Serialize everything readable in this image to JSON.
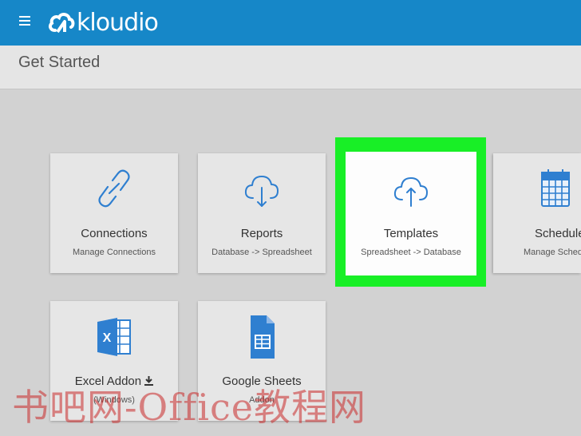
{
  "header": {
    "app_name": "kloudio",
    "menu_icon": "hamburger-menu-icon",
    "logo_icon": "cloud-logo-icon"
  },
  "page": {
    "title": "Get Started"
  },
  "colors": {
    "header_bg": "#1687c8",
    "accent_icon": "#2f7fd0",
    "highlight": "#18ef26"
  },
  "cards": [
    {
      "title": "Connections",
      "subtitle": "Manage Connections",
      "icon": "link-icon"
    },
    {
      "title": "Reports",
      "subtitle": "Database -> Spreadsheet",
      "icon": "cloud-download-icon"
    },
    {
      "title": "Templates",
      "subtitle": "Spreadsheet -> Database",
      "icon": "cloud-upload-icon",
      "highlighted": true
    },
    {
      "title": "Schedules",
      "subtitle": "Manage Schedu",
      "icon": "calendar-icon"
    },
    {
      "title": "Excel Addon",
      "subtitle": "(Windows)",
      "icon": "excel-icon"
    },
    {
      "title": "Google Sheets",
      "subtitle": "Addon",
      "icon": "google-sheets-icon"
    }
  ],
  "watermark": "书吧网-Office教程网"
}
